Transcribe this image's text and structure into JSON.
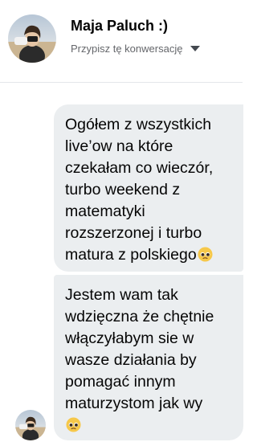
{
  "header": {
    "contact_name": "Maja Paluch :)",
    "assign_label": "Przypisz tę konwersację",
    "assign_icon": "caret-down-icon"
  },
  "messages": [
    {
      "lines": [
        "Ogółem z wszystkich",
        "live’ow na które",
        "czekałam co wieczór,",
        "turbo weekend z",
        "matematyki",
        "rozszerzonej i turbo",
        "matura z polskiego"
      ],
      "emoji": "pleading-face-icon"
    },
    {
      "lines": [
        "Jestem wam tak",
        "wdzięczna że chętnie",
        "włączyłabym sie w",
        "wasze działania by",
        "pomagać innym",
        "maturzystom jak wy"
      ],
      "emoji": "pleading-face-icon"
    }
  ],
  "colors": {
    "bubble_background": "#ebeef0",
    "text_primary": "#050505",
    "text_secondary": "#65676b",
    "divider": "#e4e6eb"
  }
}
